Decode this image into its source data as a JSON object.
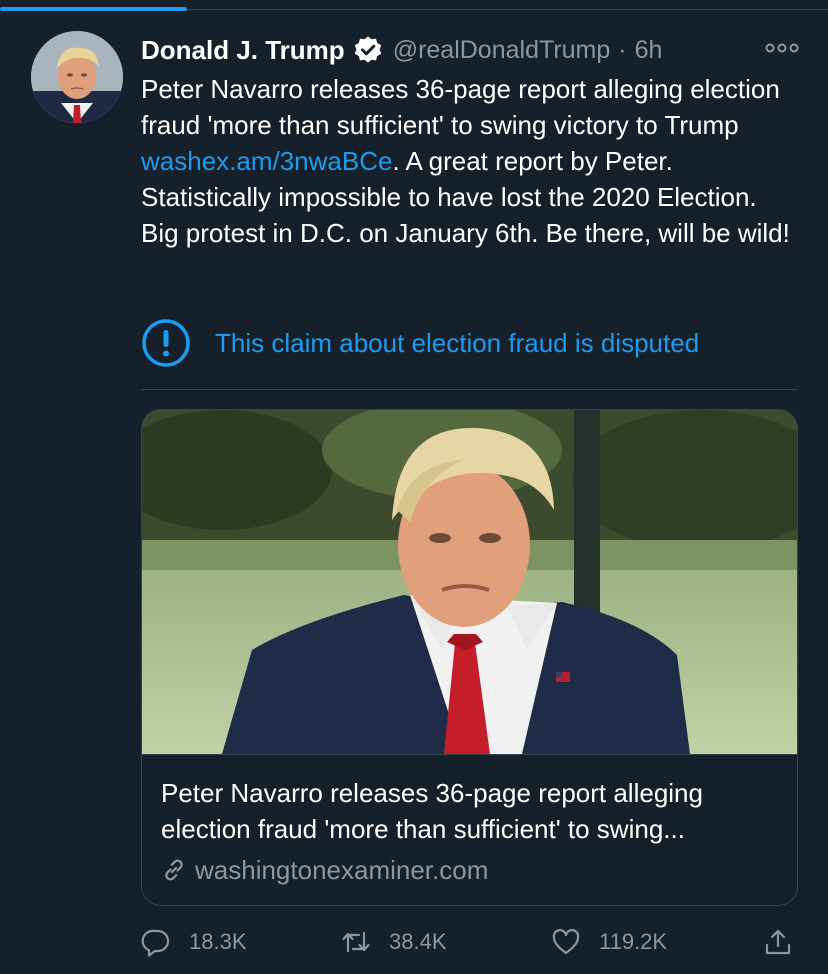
{
  "tweet": {
    "display_name": "Donald J. Trump",
    "handle": "@realDonaldTrump",
    "separator": "·",
    "time": "6h",
    "text_before_link": "Peter Navarro releases 36-page report alleging election fraud 'more than sufficient' to swing victory to Trump ",
    "link": "washex.am/3nwaBCe",
    "text_after_link": ". A great report by Peter. Statistically impossible to have lost the 2020 Election. Big protest in D.C. on January 6th. Be there, will be wild!",
    "dispute_label": "This claim about election fraud is disputed"
  },
  "card": {
    "title": "Peter Navarro releases 36-page report alleging election fraud 'more than sufficient' to swing...",
    "domain": "washingtonexaminer.com"
  },
  "actions": {
    "replies": "18.3K",
    "retweets": "38.4K",
    "likes": "119.2K"
  },
  "colors": {
    "background": "#15202b",
    "accent": "#1d9bf0",
    "muted": "#8899a6",
    "border": "#38444d"
  },
  "icons": [
    "verified-badge-icon",
    "more-options-icon",
    "warning-circle-icon",
    "link-icon",
    "reply-icon",
    "retweet-icon",
    "like-icon",
    "share-icon"
  ]
}
